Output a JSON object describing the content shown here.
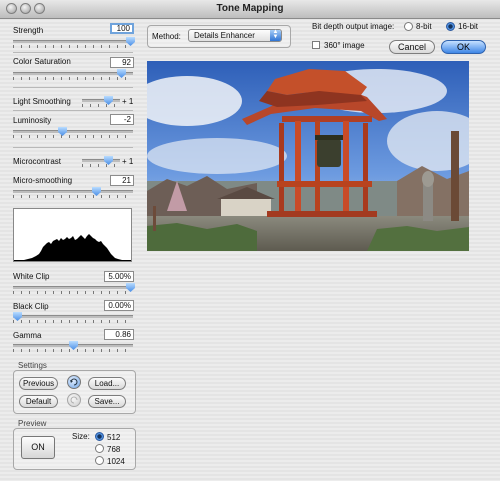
{
  "window": {
    "title": "Tone Mapping"
  },
  "controls": {
    "strength": {
      "label": "Strength",
      "value": "100",
      "level": 1.0
    },
    "color_saturation": {
      "label": "Color Saturation",
      "value": "92",
      "level": 0.92
    },
    "light_smoothing": {
      "label": "Light Smoothing",
      "suffix": "+ 1",
      "level": 0.65
    },
    "luminosity": {
      "label": "Luminosity",
      "value": "-2",
      "level": 0.4
    },
    "microcontrast": {
      "label": "Microcontrast",
      "suffix": "+ 1",
      "level": 0.65
    },
    "micro_smoothing": {
      "label": "Micro-smoothing",
      "value": "21",
      "level": 0.68
    },
    "white_clip": {
      "label": "White Clip",
      "value": "5.00%",
      "level": 1.0
    },
    "black_clip": {
      "label": "Black Clip",
      "value": "0.00%",
      "level": 0.0
    },
    "gamma": {
      "label": "Gamma",
      "value": "0.86",
      "level": 0.48
    }
  },
  "settings": {
    "title": "Settings",
    "previous_label": "Previous",
    "load_label": "Load...",
    "default_label": "Default",
    "save_label": "Save..."
  },
  "preview": {
    "title": "Preview",
    "on_label": "ON",
    "size_label": "Size:",
    "sizes": [
      "512",
      "768",
      "1024"
    ],
    "selected_size": "512"
  },
  "method": {
    "label": "Method:",
    "selected": "Details Enhancer"
  },
  "output": {
    "bit_depth_label": "Bit depth output image:",
    "options": [
      "8-bit",
      "16-bit"
    ],
    "selected": "16-bit",
    "image360_label": "360° image",
    "image360_checked": false
  },
  "buttons": {
    "cancel_label": "Cancel",
    "ok_label": "OK"
  },
  "colors": {
    "accent": "#3e86e6",
    "sky": "#4f7fd0",
    "roof": "#c4502a"
  }
}
